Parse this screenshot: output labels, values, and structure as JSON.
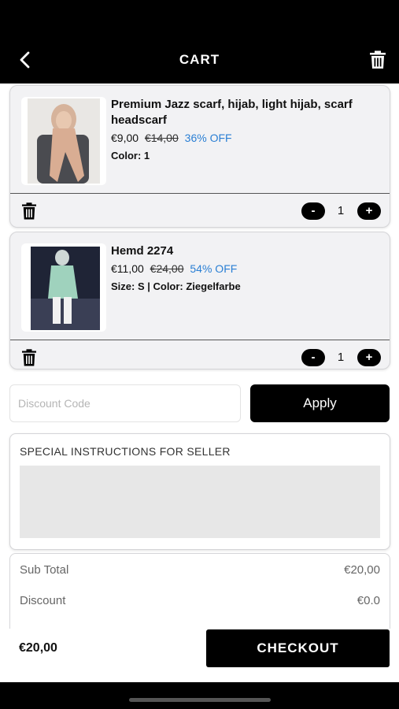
{
  "header": {
    "title": "CART",
    "back_icon": "chevron-left-icon",
    "clear_icon": "trash-icon"
  },
  "items": [
    {
      "name": "Premium Jazz scarf, hijab, light hijab, scarf headscarf",
      "price": "€9,00",
      "old_price": "€14,00",
      "discount": "36% OFF",
      "variant": "Color: 1",
      "quantity": "1",
      "minus": "-",
      "plus": "+"
    },
    {
      "name": "Hemd 2274",
      "price": "€11,00",
      "old_price": "€24,00",
      "discount": "54% OFF",
      "variant": "Size: S | Color: Ziegelfarbe",
      "quantity": "1",
      "minus": "-",
      "plus": "+"
    }
  ],
  "discount": {
    "placeholder": "Discount Code",
    "apply_label": "Apply"
  },
  "instructions": {
    "label": "SPECIAL INSTRUCTIONS FOR SELLER"
  },
  "summary": {
    "subtotal_label": "Sub Total",
    "subtotal_value": "€20,00",
    "discount_label": "Discount",
    "discount_value": "€0.0"
  },
  "footer": {
    "total": "€20,00",
    "checkout_label": "CHECKOUT"
  },
  "colors": {
    "accent": "#000000",
    "discount_text": "#2a7fd4"
  }
}
